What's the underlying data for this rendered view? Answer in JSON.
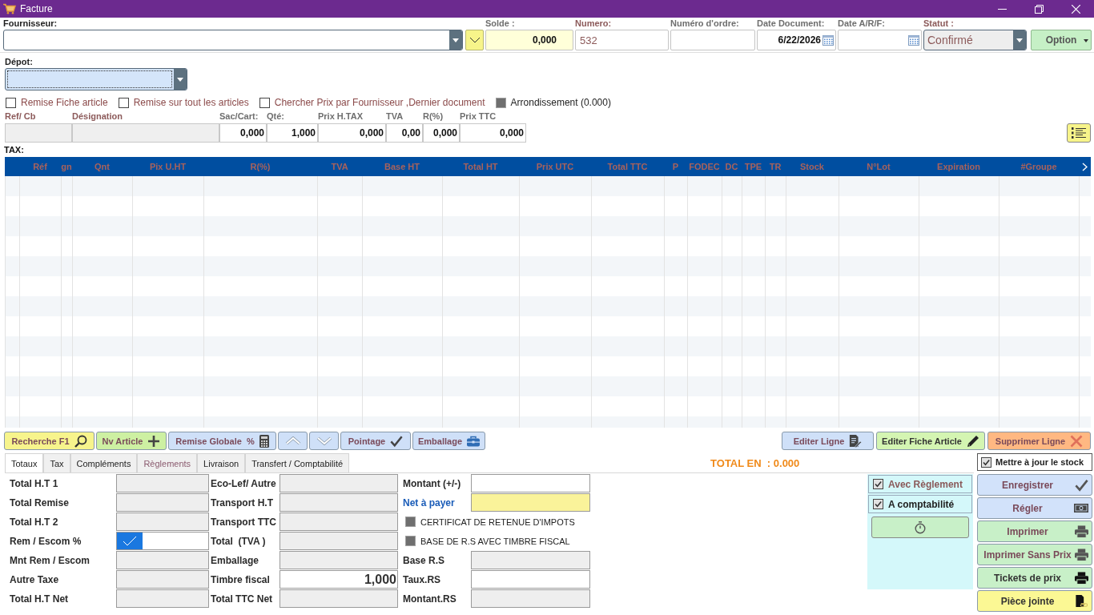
{
  "window": {
    "title": "Facture"
  },
  "header": {
    "supplier": {
      "label": "Fournisseur:"
    },
    "fields": [
      {
        "label": "Solde :",
        "kind": "balance",
        "value": "0,000"
      },
      {
        "label": "Numero:",
        "kind": "text",
        "value": "532"
      },
      {
        "label": "Numéro d'ordre:",
        "kind": "text"
      },
      {
        "label": "Date Document:",
        "kind": "date",
        "value": "6/22/2026"
      },
      {
        "label": "Date A/R/F:",
        "kind": "date"
      },
      {
        "label": "Statut :",
        "kind": "combo",
        "value": "Confirmé"
      }
    ],
    "option_button": "Option"
  },
  "depot": {
    "label": "Dépot:"
  },
  "options": [
    {
      "label": "Remise Fiche article",
      "checked": false,
      "disabled": false
    },
    {
      "label": "Remise sur tout les articles",
      "checked": false,
      "disabled": false
    },
    {
      "label": "Chercher Prix par Fournisseur ,Dernier document",
      "checked": false,
      "disabled": false
    },
    {
      "label": "Arrondissement (0.000)",
      "checked": false,
      "disabled": true
    }
  ],
  "line_entry": [
    {
      "label": "Ref/ Cb",
      "kind": "readonly"
    },
    {
      "label": "Désignation",
      "kind": "readonly"
    },
    {
      "label": "Sac/Cart:",
      "kind": "input",
      "value": "0,000"
    },
    {
      "label": "Qté:",
      "kind": "input",
      "value": "1,000"
    },
    {
      "label": "Prix H.TAX",
      "kind": "input",
      "value": "0,000"
    },
    {
      "label": "TVA",
      "kind": "input",
      "value": "0,00"
    },
    {
      "label": "R(%)",
      "kind": "input",
      "value": "0,000"
    },
    {
      "label": "Prix TTC",
      "kind": "input",
      "value": "0,000"
    }
  ],
  "tax_label": "TAX:",
  "table": {
    "columns": [
      "Réf",
      "gn",
      "Qnt",
      "Pix U.HT",
      "R(%)",
      "TVA",
      "Base HT",
      "Total HT",
      "Prix UTC",
      "Total TTC",
      "P",
      "FODEC",
      "DC",
      "TPE",
      "TR",
      "Stock",
      "N°Lot",
      "Expiration",
      "#Groupe"
    ]
  },
  "toolbar": {
    "left": [
      {
        "label": "Recherche F1",
        "kind": "search"
      },
      {
        "label": "Nv Article",
        "kind": "add"
      },
      {
        "label": "Remise Globale  %",
        "kind": "discount"
      },
      {
        "kind": "up"
      },
      {
        "kind": "down"
      },
      {
        "label": "Pointage",
        "kind": "check"
      },
      {
        "label": "Emballage",
        "kind": "package"
      }
    ],
    "right": [
      {
        "label": "Editer Ligne",
        "kind": "edit-line"
      },
      {
        "label": "Editer Fiche Article",
        "kind": "edit-article"
      },
      {
        "label": "Supprimer Ligne",
        "kind": "delete"
      }
    ]
  },
  "tabs": [
    {
      "label": "Totaux",
      "selected": true,
      "disabled": false
    },
    {
      "label": "Tax",
      "selected": false,
      "disabled": false
    },
    {
      "label": "Compléments",
      "selected": false,
      "disabled": false
    },
    {
      "label": "Règlements",
      "selected": false,
      "disabled": true
    },
    {
      "label": "Livraison",
      "selected": false,
      "disabled": false
    },
    {
      "label": "Transfert / Comptabilité",
      "selected": false,
      "disabled": false
    }
  ],
  "total_en": "TOTAL EN  : 0.000",
  "update_stock": {
    "label": "Mettre à jour le stock",
    "checked": true
  },
  "totals": {
    "columns": [
      [
        {
          "label": "Total H.T 1",
          "kind": "readonly"
        },
        {
          "label": "Total Remise",
          "kind": "readonly"
        },
        {
          "label": "Total H.T 2",
          "kind": "readonly"
        },
        {
          "label": "Rem / Escom %",
          "kind": "toggle",
          "checked": true
        },
        {
          "label": "Mnt Rem / Escom",
          "kind": "readonly"
        },
        {
          "label": "Autre Taxe",
          "kind": "readonly"
        },
        {
          "label": "Total H.T Net",
          "kind": "readonly"
        }
      ],
      [
        {
          "label": "Eco-Lef/ Autre",
          "kind": "readonly"
        },
        {
          "label": "Transport H.T",
          "kind": "readonly"
        },
        {
          "label": "Transport TTC",
          "kind": "readonly"
        },
        {
          "label": "Total  (TVA )",
          "kind": "readonly"
        },
        {
          "label": "Emballage",
          "kind": "readonly"
        },
        {
          "label": "Timbre fiscal",
          "kind": "input",
          "value": "1,000"
        },
        {
          "label": "Total TTC Net",
          "kind": "readonly"
        }
      ],
      [
        {
          "label": "Montant (+/-)",
          "kind": "input"
        },
        {
          "label": "Net à payer",
          "kind": "highlight"
        },
        {
          "label": "CERTIFICAT DE RETENUE D'IMPOTS",
          "kind": "checkbox",
          "checked": false,
          "disabled": true
        },
        {
          "label": "BASE DE R.S AVEC TIMBRE FISCAL",
          "kind": "checkbox",
          "checked": false,
          "disabled": true
        },
        {
          "label": "Base R.S",
          "kind": "readonly"
        },
        {
          "label": "Taux.RS",
          "kind": "input"
        },
        {
          "label": "Montant.RS",
          "kind": "readonly"
        }
      ]
    ]
  },
  "payment_panel": {
    "options": [
      {
        "label": "Avec Règlement",
        "checked": true
      },
      {
        "label": "A comptabilité",
        "checked": true
      }
    ]
  },
  "actions": [
    {
      "label": "Enregistrer",
      "kind": "save"
    },
    {
      "label": "Régler",
      "kind": "pay"
    },
    {
      "label": "Imprimer",
      "kind": "print"
    },
    {
      "label": "Imprimer Sans Prix",
      "kind": "print"
    },
    {
      "label": "Tickets de prix",
      "kind": "print-dark"
    },
    {
      "label": "Pièce jointe",
      "kind": "attach"
    }
  ]
}
